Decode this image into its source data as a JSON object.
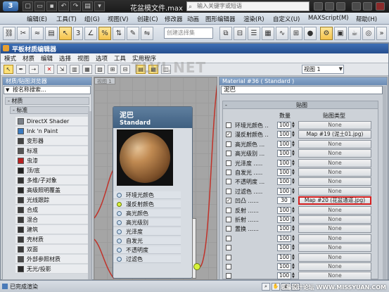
{
  "app": {
    "title": "花盆模文件.max",
    "search_placeholder": "输入关键字或短语",
    "logo": "3"
  },
  "menubar": [
    "编辑(E)",
    "工具(T)",
    "组(G)",
    "视图(V)",
    "创建(C)",
    "修改器",
    "动画",
    "图形编辑器",
    "渲染(R)",
    "自定义(U)",
    "MAXScript(M)",
    "帮助(H)"
  ],
  "toolbar": {
    "selection_set_placeholder": "创建选择集",
    "angle_snap_label": "3",
    "snap_toggle_label": "%"
  },
  "material_editor": {
    "window_title": "平板材质编辑器",
    "menu": [
      "模式",
      "材质",
      "编辑",
      "选择",
      "视图",
      "选项",
      "工具",
      "实用程序"
    ],
    "view_select": "视图 1",
    "watermark": "TLVI.NET"
  },
  "browser": {
    "header": "材质/贴图浏览器",
    "search_placeholder": "按名称搜索...",
    "group": "- 材质",
    "subgroup": "- 标准",
    "items": [
      {
        "label": "DirectX Shader",
        "swatch": "#7a8088"
      },
      {
        "label": "Ink 'n Paint",
        "swatch": "#3a7ac0"
      },
      {
        "label": "变形器",
        "swatch": "#444444"
      },
      {
        "label": "标准",
        "swatch": "#555555"
      },
      {
        "label": "虫漆",
        "swatch": "#b82020"
      },
      {
        "label": "顶/底",
        "swatch": "#222222"
      },
      {
        "label": "多维/子对象",
        "swatch": "#333333"
      },
      {
        "label": "高级照明覆盖",
        "swatch": "#2a2a2a"
      },
      {
        "label": "光线跟踪",
        "swatch": "#3a3a3a"
      },
      {
        "label": "合成",
        "swatch": "#3a3a3a"
      },
      {
        "label": "混合",
        "swatch": "#3a3a3a"
      },
      {
        "label": "建筑",
        "swatch": "#303030"
      },
      {
        "label": "壳材质",
        "swatch": "#3a3a3a"
      },
      {
        "label": "双面",
        "swatch": "#3a3a3a"
      },
      {
        "label": "外部参照材质",
        "swatch": "#4a4a4a"
      },
      {
        "label": "无光/投影",
        "swatch": "#2a2a2a"
      }
    ]
  },
  "view": {
    "tab": "视图 1"
  },
  "node": {
    "name": "泥巴",
    "type": "Standard",
    "slots": [
      {
        "label": "环境光颜色",
        "connected": false
      },
      {
        "label": "漫反射颜色",
        "connected": true
      },
      {
        "label": "高光颜色",
        "connected": false
      },
      {
        "label": "高光级别",
        "connected": false
      },
      {
        "label": "光泽度",
        "connected": false
      },
      {
        "label": "自发光",
        "connected": false
      },
      {
        "label": "不透明度",
        "connected": false
      },
      {
        "label": "过滤色",
        "connected": false
      }
    ]
  },
  "params": {
    "title": "Material #36 ( Standard )",
    "material_name": "泥巴",
    "rollout_title": "贴图",
    "col_amount": "数量",
    "col_maptype": "贴图类型",
    "rows": [
      {
        "label": "环境光颜色 ..",
        "amount": "100",
        "map": "None",
        "checked": false,
        "highlight": false
      },
      {
        "label": "漫反射颜色 ..",
        "amount": "100",
        "map": "Map #19 (泥土01.jpg)",
        "checked": true,
        "highlight": false
      },
      {
        "label": "高光颜色 ...",
        "amount": "100",
        "map": "None",
        "checked": false,
        "highlight": false
      },
      {
        "label": "高光级别 ...",
        "amount": "100",
        "map": "None",
        "checked": false,
        "highlight": false
      },
      {
        "label": "光泽度 .....",
        "amount": "100",
        "map": "None",
        "checked": false,
        "highlight": false
      },
      {
        "label": "自发光 .....",
        "amount": "100",
        "map": "None",
        "checked": false,
        "highlight": false
      },
      {
        "label": "不透明度 ...",
        "amount": "100",
        "map": "None",
        "checked": false,
        "highlight": false
      },
      {
        "label": "过滤色 .....",
        "amount": "100",
        "map": "None",
        "checked": false,
        "highlight": false
      },
      {
        "label": "凹凸 ......",
        "amount": "30",
        "map": "Map #20 (花盆通道.jpg)",
        "checked": true,
        "highlight": true
      },
      {
        "label": "反射 ......",
        "amount": "100",
        "map": "None",
        "checked": false,
        "highlight": false
      },
      {
        "label": "折射 ......",
        "amount": "100",
        "map": "None",
        "checked": false,
        "highlight": false
      },
      {
        "label": "置换 ......",
        "amount": "100",
        "map": "None",
        "checked": false,
        "highlight": false
      },
      {
        "label": "",
        "amount": "100",
        "map": "None",
        "checked": false,
        "highlight": false
      },
      {
        "label": "",
        "amount": "100",
        "map": "None",
        "checked": false,
        "highlight": false
      },
      {
        "label": "",
        "amount": "100",
        "map": "None",
        "checked": false,
        "highlight": false
      },
      {
        "label": "",
        "amount": "100",
        "map": "None",
        "checked": false,
        "highlight": false
      },
      {
        "label": "",
        "amount": "100",
        "map": "None",
        "checked": false,
        "highlight": false
      },
      {
        "label": "",
        "amount": "100",
        "map": "None",
        "checked": false,
        "highlight": false
      }
    ]
  },
  "status": {
    "text": "已完成渲染",
    "credit": "思缘设计论坛  WWW.MISSYUAN.COM"
  },
  "colors": {
    "title_bg": "#1a1a1a",
    "editor_title": "#2f5a9c",
    "highlight_red": "#d62020",
    "connected_port": "#d8f23a"
  }
}
